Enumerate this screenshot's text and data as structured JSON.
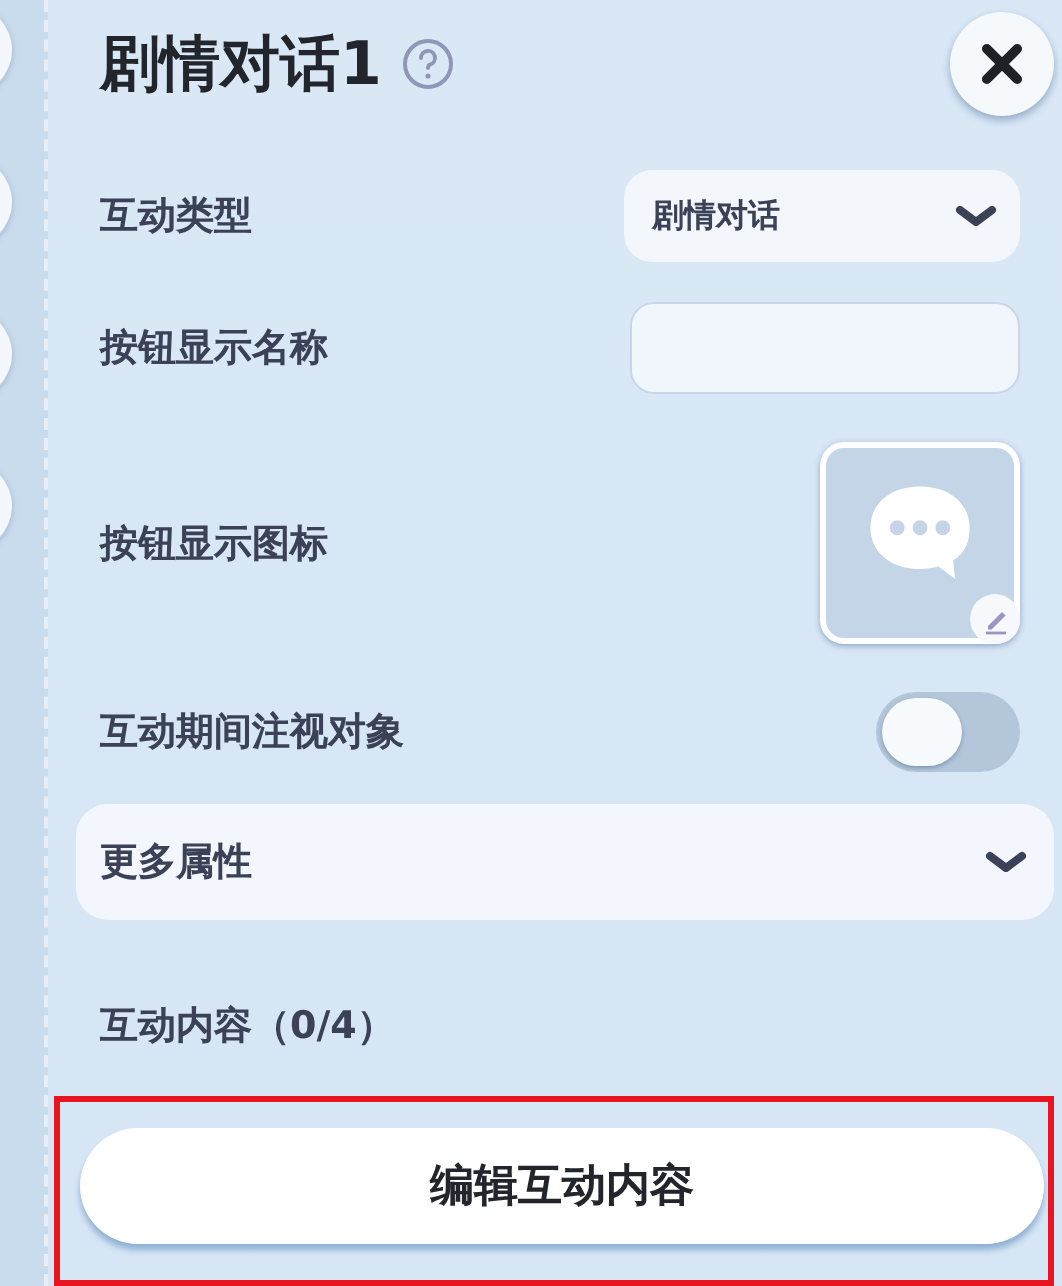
{
  "title": "剧情对话1",
  "fields": [
    {
      "kind": "select",
      "label": "互动类型",
      "value": "剧情对话"
    },
    {
      "kind": "text",
      "label": "按钮显示名称"
    },
    {
      "kind": "icon",
      "label": "按钮显示图标"
    },
    {
      "kind": "toggle",
      "label": "互动期间注视对象",
      "on": false
    }
  ],
  "more_section": {
    "label": "更多属性",
    "expanded": false
  },
  "content_count": "互动内容（0/4）",
  "edit_button": {
    "label": "编辑互动内容",
    "highlighted": true
  }
}
